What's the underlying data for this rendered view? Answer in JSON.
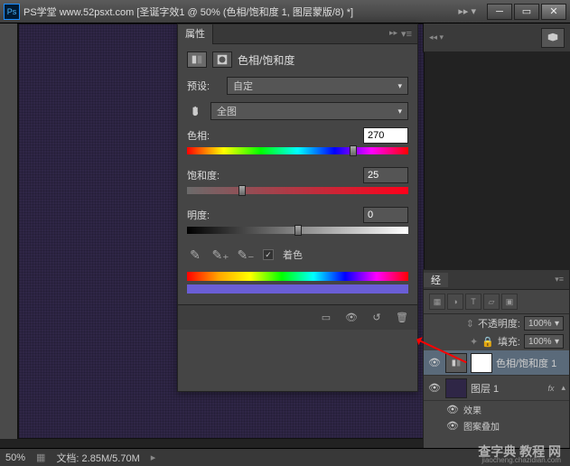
{
  "title_bar": {
    "ps": "Ps",
    "site": "PS学堂  www.52psxt.com",
    "doc": "[圣诞字效1 @ 50% (色相/饱和度 1, 图层蒙版/8) *]"
  },
  "properties": {
    "tab": "属性",
    "title": "色相/饱和度",
    "preset_label": "预设:",
    "preset_value": "自定",
    "range_value": "全图",
    "hue": {
      "label": "色相:",
      "value": "270",
      "pos": 75
    },
    "saturation": {
      "label": "饱和度:",
      "value": "25",
      "pos": 25
    },
    "lightness": {
      "label": "明度:",
      "value": "0",
      "pos": 50
    },
    "colorize": "着色",
    "colorize_checked": "✓"
  },
  "extra_tab": "经",
  "layers": {
    "blend_mode": "",
    "opacity_label": "不透明度:",
    "opacity_value": "100%",
    "lock_label": "锁定:",
    "fill_label": "填充:",
    "fill_value": "100%",
    "layer1_name": "色相/饱和度 1",
    "layer2_name": "图层 1",
    "fx": "fx",
    "effects": "效果",
    "effect_item": "图案叠加"
  },
  "status": {
    "zoom": "50%",
    "doc_info": "文档: 2.85M/5.70M"
  },
  "watermark": {
    "main": "查字典 教程 网",
    "sub": "jiaocheng.chazidian.com"
  }
}
